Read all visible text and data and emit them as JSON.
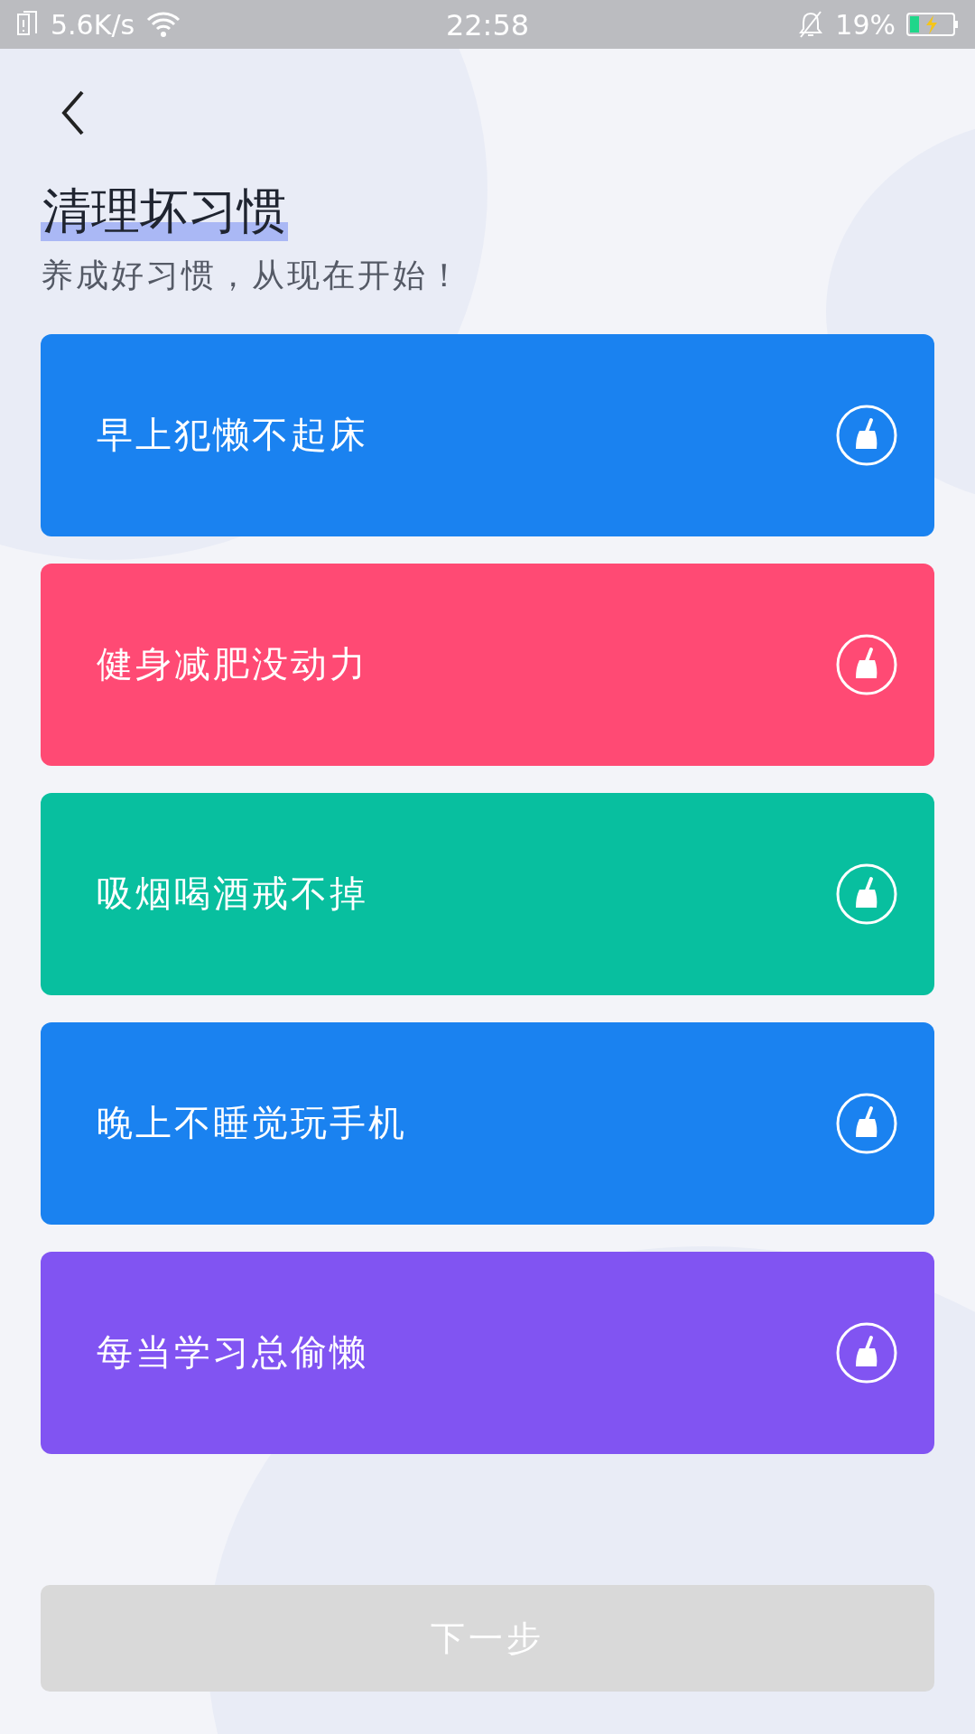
{
  "status_bar": {
    "speed": "5.6K/s",
    "time": "22:58",
    "battery": "19%"
  },
  "header": {
    "title": "清理坏习惯",
    "subtitle": "养成好习惯，从现在开始！"
  },
  "habits": [
    {
      "label": "早上犯懒不起床",
      "color": "#1a82f0"
    },
    {
      "label": "健身减肥没动力",
      "color": "#ff4a74"
    },
    {
      "label": "吸烟喝酒戒不掉",
      "color": "#08bf9f"
    },
    {
      "label": "晚上不睡觉玩手机",
      "color": "#1a82f0"
    },
    {
      "label": "每当学习总偷懒",
      "color": "#8154f2"
    }
  ],
  "next_button": {
    "label": "下一步",
    "disabled": true
  }
}
